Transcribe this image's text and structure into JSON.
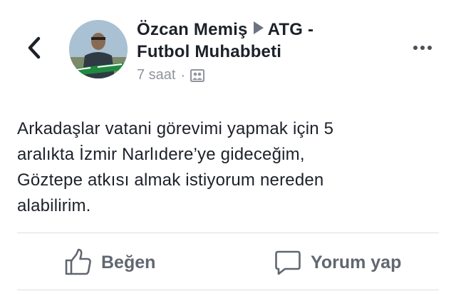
{
  "post": {
    "author": "Özcan Memiş",
    "group": "ATG -",
    "group_line2": "Futbol Muhabbeti",
    "time": "7 saat",
    "separator": "·",
    "audience_icon": "group-audience-icon",
    "body_lines": [
      "Arkadaşlar vatani görevimi yapmak için 5",
      "aralıkta İzmir Narlıdere’ye gideceğim,",
      "Göztepe atkısı almak istiyorum nereden",
      "alabilirim."
    ]
  },
  "actions": {
    "like_label": "Beğen",
    "comment_label": "Yorum yap"
  },
  "colors": {
    "text": "#1d2129",
    "meta": "#90949c",
    "action": "#606770",
    "divider": "#dddfe2"
  }
}
